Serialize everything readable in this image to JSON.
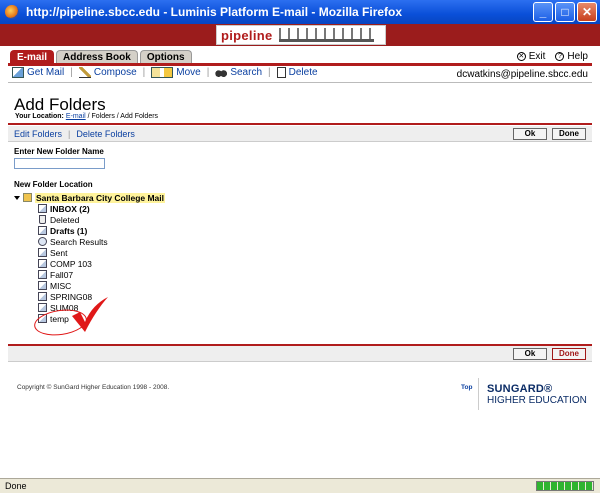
{
  "window": {
    "title": "http://pipeline.sbcc.edu - Luminis Platform E-mail - Mozilla Firefox",
    "minimize": "_",
    "maximize": "□",
    "close": "✕"
  },
  "banner": {
    "logo_text": "pipeline"
  },
  "tabs": [
    {
      "label": "E-mail",
      "active": true
    },
    {
      "label": "Address Book",
      "active": false
    },
    {
      "label": "Options",
      "active": false
    }
  ],
  "top_links": {
    "exit": "Exit",
    "help": "Help"
  },
  "toolbar": {
    "get_mail": "Get Mail",
    "compose": "Compose",
    "move": "Move",
    "search": "Search",
    "delete": "Delete",
    "user_email": "dcwatkins@pipeline.sbcc.edu"
  },
  "heading": {
    "title": "Add Folders",
    "location_label": "Your Location:",
    "location_link": "E-mail",
    "location_rest": " / Folders / Add Folders"
  },
  "actions": {
    "edit_folders": "Edit Folders",
    "separator": "|",
    "delete_folders": "Delete Folders",
    "ok": "Ok",
    "done": "Done"
  },
  "form": {
    "new_folder_label": "Enter New Folder Name",
    "new_folder_value": "",
    "location_label": "New Folder Location"
  },
  "tree": {
    "root": "Santa Barbara City College Mail",
    "folders": [
      {
        "label": "INBOX (2)",
        "icon": "inbox-icon",
        "bold": true
      },
      {
        "label": "Deleted",
        "icon": "trash-icon",
        "bold": false
      },
      {
        "label": "Drafts (1)",
        "icon": "folder-icon",
        "bold": true
      },
      {
        "label": "Search Results",
        "icon": "search-folder-icon",
        "bold": false
      },
      {
        "label": "Sent",
        "icon": "folder-icon",
        "bold": false
      },
      {
        "label": "COMP 103",
        "icon": "folder-icon",
        "bold": false
      },
      {
        "label": "Fall07",
        "icon": "folder-icon",
        "bold": false
      },
      {
        "label": "MISC",
        "icon": "folder-icon",
        "bold": false
      },
      {
        "label": "SPRING08",
        "icon": "folder-icon",
        "bold": false
      },
      {
        "label": "SUM08",
        "icon": "folder-icon",
        "bold": false
      },
      {
        "label": "temp",
        "icon": "folder-icon",
        "bold": false
      }
    ]
  },
  "footer": {
    "copyright": "Copyright © SunGard Higher Education 1998 - 2008.",
    "top_link": "Top",
    "brand_line1": "SUNGARD®",
    "brand_line2": "HIGHER EDUCATION"
  },
  "status": {
    "text": "Done"
  },
  "colors": {
    "accent": "#b01c1c",
    "link": "#0a3fa0",
    "annotation": "#e01818"
  }
}
